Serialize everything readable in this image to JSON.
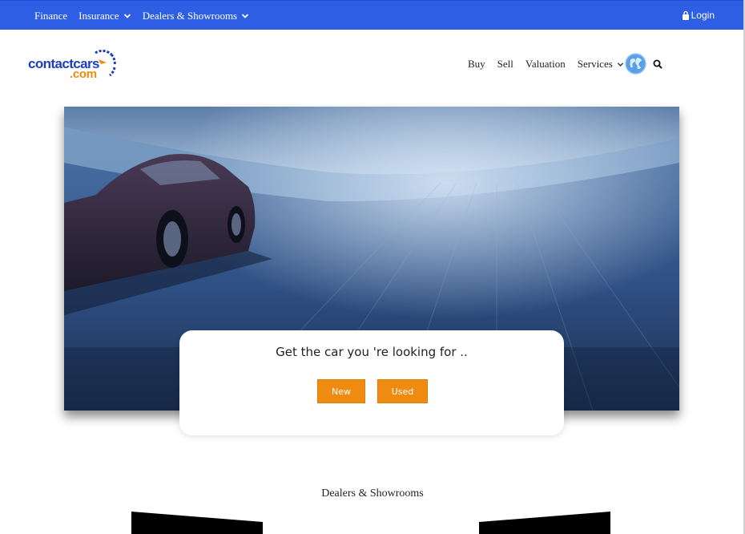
{
  "topbar": {
    "items": [
      {
        "label": "Finance",
        "has_dropdown": false
      },
      {
        "label": "Insurance",
        "has_dropdown": true
      },
      {
        "label": "Dealers & Showrooms",
        "has_dropdown": true
      }
    ],
    "login_label": "Login",
    "bg_color": "#2d5ee4"
  },
  "logo": {
    "text_main": "contactcars",
    "text_sub": ".com"
  },
  "nav": {
    "items": [
      {
        "label": "Buy"
      },
      {
        "label": "Sell"
      },
      {
        "label": "Valuation"
      },
      {
        "label": "Services",
        "has_dropdown": true
      }
    ]
  },
  "hero": {
    "search_title": "Get the car you 're looking for ..",
    "new_label": "New",
    "used_label": "Used",
    "accent_color": "#f08b12"
  },
  "dealers": {
    "title": "Dealers & Showrooms"
  },
  "icons": {
    "lock": "lock-icon",
    "chevron": "chevron-down-icon",
    "globe": "globe-icon",
    "search": "search-icon"
  }
}
